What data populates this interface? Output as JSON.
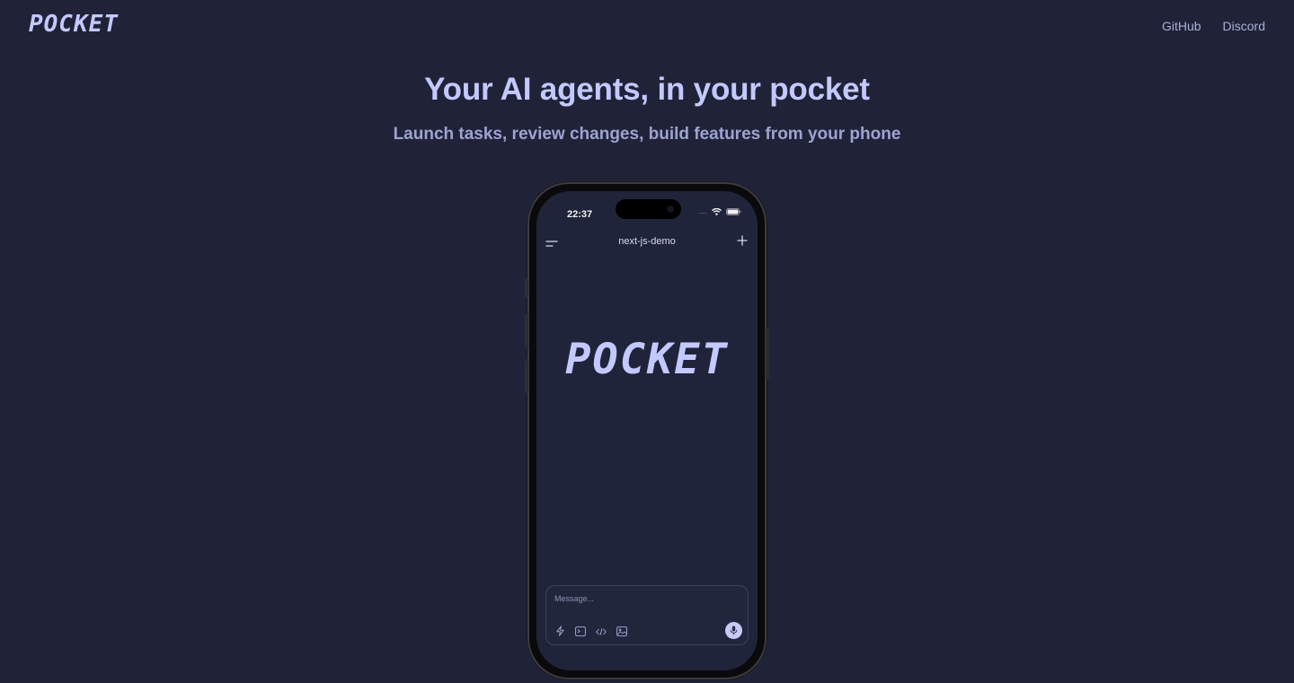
{
  "header": {
    "logo": "POCKET",
    "nav": [
      {
        "label": "GitHub"
      },
      {
        "label": "Discord"
      }
    ]
  },
  "hero": {
    "title": "Your AI agents, in your pocket",
    "subtitle": "Launch tasks, review changes, build features from your phone"
  },
  "phone": {
    "status_time": "22:37",
    "signal": "....",
    "status_icons": [
      "wifi-icon",
      "battery-icon"
    ],
    "app_bar": {
      "title": "next-js-demo",
      "left_icon": "menu-icon",
      "right_icon": "plus-icon"
    },
    "logo": "POCKET",
    "composer": {
      "placeholder": "Message...",
      "tools": [
        "lightning-icon",
        "terminal-icon",
        "code-icon",
        "image-icon"
      ],
      "send_icon": "microphone-icon"
    }
  },
  "colors": {
    "background": "#202338",
    "accent": "#c3c9ff",
    "muted": "#9ea3d0"
  }
}
